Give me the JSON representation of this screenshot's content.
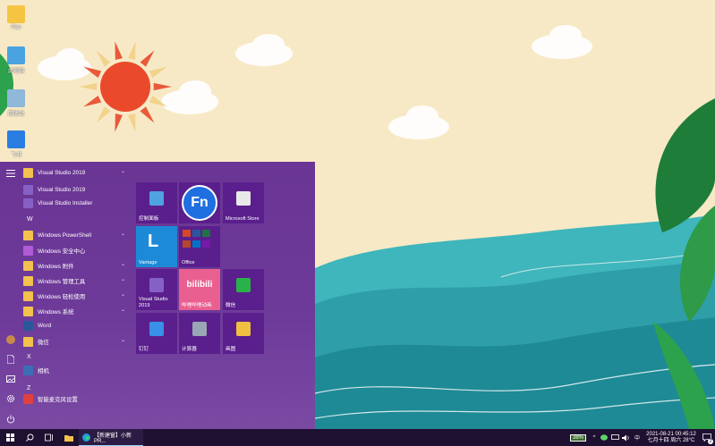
{
  "desktop_icons": [
    {
      "id": "user",
      "label": "Pan",
      "color": "#f5c542"
    },
    {
      "id": "pc",
      "label": "此电脑",
      "color": "#4aa3df"
    },
    {
      "id": "recycle",
      "label": "回收站",
      "color": "#8fb8d9"
    },
    {
      "id": "app",
      "label": "飞书",
      "color": "#2a7de1"
    }
  ],
  "app_list": {
    "rows": [
      {
        "kind": "folder",
        "label": "Visual Studio 2019",
        "expand": true
      },
      {
        "kind": "vs",
        "label": "Visual Studio 2019"
      },
      {
        "kind": "vs",
        "label": "Visual Studio Installer"
      },
      {
        "kind": "letter",
        "label": "W"
      },
      {
        "kind": "folder",
        "label": "Windows PowerShell",
        "expand": true
      },
      {
        "kind": "shield",
        "label": "Windows 安全中心"
      },
      {
        "kind": "folder",
        "label": "Windows 附件",
        "expand": true
      },
      {
        "kind": "folder",
        "label": "Windows 管理工具",
        "expand": true
      },
      {
        "kind": "folder",
        "label": "Windows 轻松使用",
        "expand": true
      },
      {
        "kind": "folder",
        "label": "Windows 系统",
        "expand": true
      },
      {
        "kind": "word",
        "label": "Word"
      },
      {
        "kind": "folder",
        "label": "微信",
        "expand": true
      },
      {
        "kind": "letter",
        "label": "X"
      },
      {
        "kind": "camera",
        "label": "相机",
        "sub": ""
      },
      {
        "kind": "letter",
        "label": "Z"
      },
      {
        "kind": "mic",
        "label": "智能麦克风设置",
        "sub": ""
      }
    ]
  },
  "tiles": [
    {
      "label": "控制面板",
      "bg": "#5a1f8c",
      "icon": "control-panel-icon",
      "accent": "#4fa3e0"
    },
    {
      "label": "Fn",
      "bg": "#5a1f8c",
      "icon": "fn-icon",
      "accent": "#1f6fe0"
    },
    {
      "label": "Microsoft Store",
      "bg": "#5a1f8c",
      "icon": "store-icon",
      "accent": "#e8e8e8"
    },
    {
      "label": "Vantage",
      "bg": "#1d8ad8",
      "icon": "vantage-icon",
      "accent": "#ffffff"
    },
    {
      "label": "Office",
      "bg": "#5a1f8c",
      "icon": "office-icon",
      "accent": "#d24726"
    },
    {
      "label": "Visual Studio 2019",
      "bg": "#5a1f8c",
      "icon": "visual-studio-icon",
      "accent": "#8661c5"
    },
    {
      "label": "哔哩哔哩动画",
      "bg": "#e95f8f",
      "icon": "bilibili-icon",
      "accent": "#ffffff"
    },
    {
      "label": "微信",
      "bg": "#5a1f8c",
      "icon": "wechat-icon",
      "accent": "#2ab24a"
    },
    {
      "label": "钉钉",
      "bg": "#5a1f8c",
      "icon": "dingtalk-icon",
      "accent": "#3a8fe8"
    },
    {
      "label": "计算器",
      "bg": "#5a1f8c",
      "icon": "calculator-icon",
      "accent": "#9aa6b3"
    },
    {
      "label": "画图",
      "bg": "#5a1f8c",
      "icon": "paint-icon",
      "accent": "#f0c040"
    }
  ],
  "tile_text": {
    "fn": "Fn",
    "vantage": "L",
    "bilibili": "bilibili",
    "bilibili_sub": "哔哩哔哩动画"
  },
  "taskbar": {
    "edge_label": "【新建窗】小新PR...",
    "battery": "38%",
    "ime": "中",
    "datetime": "2021-08-21 00:45:12",
    "lunar": "七月十四 周六 28°C",
    "notif_count": "2"
  }
}
